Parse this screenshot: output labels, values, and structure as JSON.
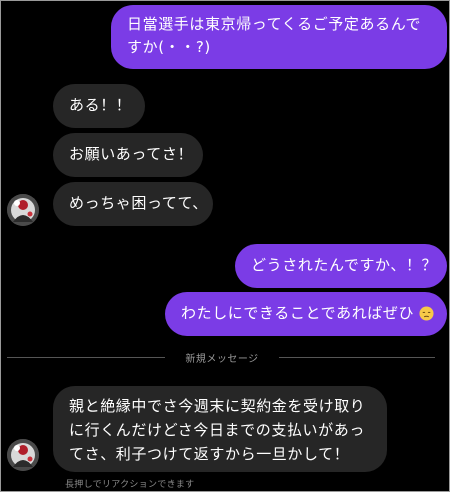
{
  "conversation": {
    "messages": [
      {
        "side": "sent",
        "text": "日當選手は東京帰ってくるご予定あるんですか(・・?)"
      },
      {
        "side": "received",
        "text": "ある！！"
      },
      {
        "side": "received",
        "text": "お願いあってさ！"
      },
      {
        "side": "received",
        "text": "めっちゃ困ってて、"
      },
      {
        "side": "sent",
        "text": "どうされたんですか、！？"
      },
      {
        "side": "sent",
        "text": "わたしにできることであればぜひ",
        "emoji": "pensive-face"
      },
      {
        "side": "received",
        "text": "親と絶縁中でさ今週末に契約金を受け取りに行くんだけどさ今日までの支払いがあってさ、利子つけて返すから一旦かして！"
      }
    ],
    "divider_label": "新規メッセージ",
    "hint": "長押しでリアクションできます"
  },
  "colors": {
    "background": "#000000",
    "sent_bubble": "#7b3ce6",
    "received_bubble": "#262626",
    "muted_text": "#9a9a9a"
  }
}
